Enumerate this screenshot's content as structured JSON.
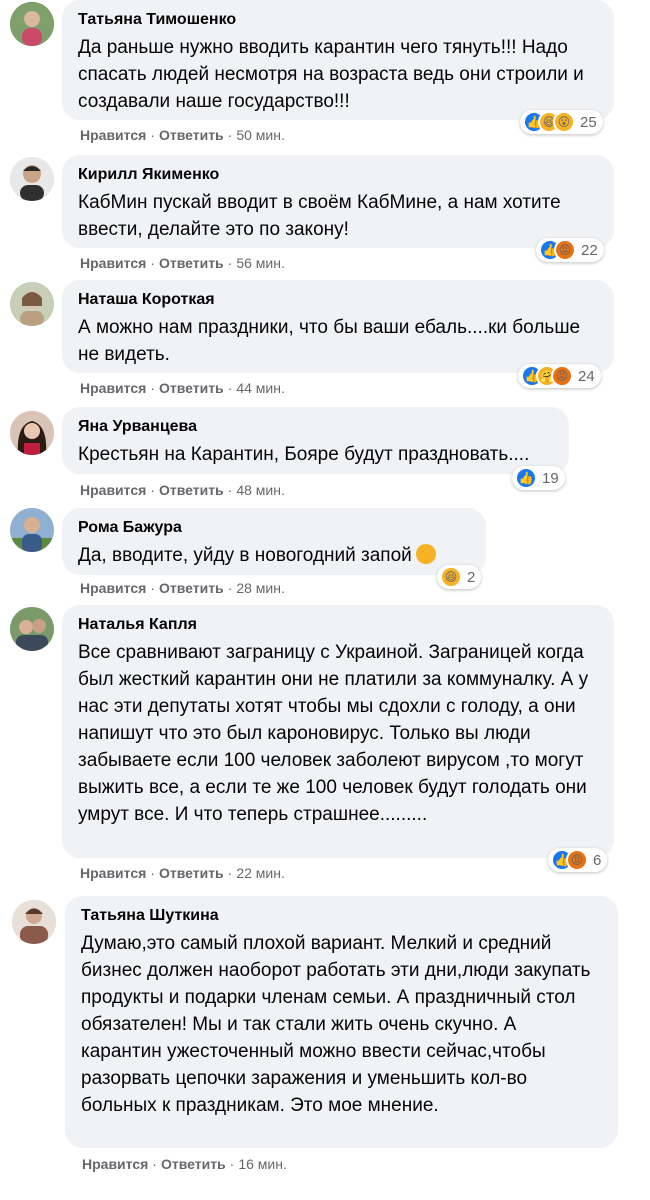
{
  "actions": {
    "like": "Нравится",
    "reply": "Ответить"
  },
  "comments": [
    {
      "author": "Татьяна Тимошенко",
      "text": "Да раньше нужно вводить карантин чего тянуть!!! Надо спасать людей несмотря на возраста ведь они строили и создавали наше государство!!!",
      "time": "50 мин.",
      "reactions": [
        "like",
        "haha",
        "wow"
      ],
      "reaction_count": "25",
      "avatar_color": "#6b8e5a"
    },
    {
      "author": "Кирилл Якименко",
      "text": "КабМин пускай вводит в своём КабМине, а нам хотите ввести, делайте это по закону!",
      "time": "56 мин.",
      "reactions": [
        "like",
        "angry"
      ],
      "reaction_count": "22",
      "avatar_color": "#4a4a4a"
    },
    {
      "author": "Наташа Короткая",
      "text": "А можно нам праздники, что бы ваши ебаль....ки больше не видеть.",
      "time": "44 мин.",
      "reactions": [
        "like",
        "care",
        "angry"
      ],
      "reaction_count": "24",
      "avatar_color": "#c8a98a"
    },
    {
      "author": "Яна Урванцева",
      "text": "Крестьян на Карантин, Бояре будут праздновать....",
      "time": "48 мин.",
      "reactions": [
        "like"
      ],
      "reaction_count": "19",
      "avatar_color": "#3a2a24"
    },
    {
      "author": "Рома Бажура",
      "text": "Да, вводите, уйду в новогодний запой",
      "time": "28 мин.",
      "reactions": [
        "haha"
      ],
      "reaction_count": "2",
      "avatar_color": "#5a7fa8"
    },
    {
      "author": "Наталья Капля",
      "text": "Все сравнивают заграницу с Украиной. Заграницей когда был жесткий карантин они не платили за коммуналку. А у нас эти депутаты хотят чтобы мы сдохли с голоду, а они напишут что это был кароновирус. Только вы люди забываете если 100 человек заболеют вирусом ,то могут выжить все, а если те же 100 человек будут голодать они умрут все. И что теперь страшнее.........",
      "time": "22 мин.",
      "reactions": [
        "like",
        "angry"
      ],
      "reaction_count": "6",
      "avatar_color": "#6a8a5a"
    },
    {
      "author": "Татьяна Шуткина",
      "text": "Думаю,это самый плохой вариант. Мелкий и средний бизнес должен наоборот работать эти дни,люди закупать продукты и подарки членам семьи. А праздничный стол обязателен! Мы и так стали жить очень скучно. А карантин ужесточенный можно ввести сейчас,чтобы разорвать цепочки заражения и уменьшить кол-во больных к праздникам. Это мое мнение.",
      "time": "16 мин.",
      "reactions": [],
      "reaction_count": "",
      "avatar_color": "#9a7a6a"
    }
  ],
  "icons": {
    "like": "thumbs-up-icon",
    "haha": "laughing-face-icon",
    "wow": "surprised-face-icon",
    "care": "care-face-icon",
    "angry": "angry-face-icon"
  }
}
